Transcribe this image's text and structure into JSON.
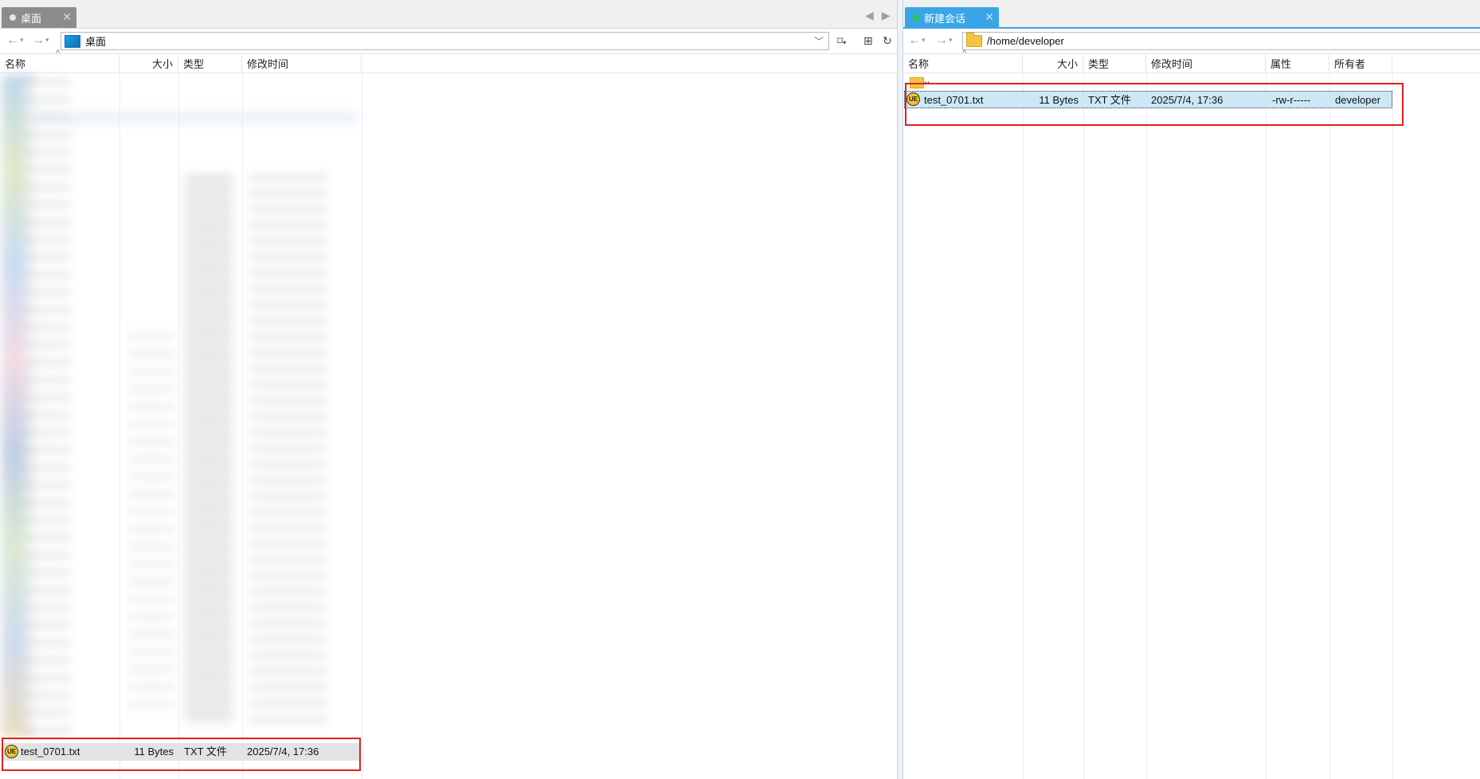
{
  "left_pane": {
    "tab": {
      "label": "桌面"
    },
    "address": "桌面",
    "columns": {
      "name": "名称",
      "size": "大小",
      "type": "类型",
      "modified": "修改时间"
    },
    "file": {
      "name": "test_0701.txt",
      "size": "11 Bytes",
      "type": "TXT 文件",
      "modified": "2025/7/4, 17:36"
    }
  },
  "right_pane": {
    "tab": {
      "label": "新建会话"
    },
    "address": "/home/developer",
    "columns": {
      "name": "名称",
      "size": "大小",
      "type": "类型",
      "modified": "修改时间",
      "attrs": "属性",
      "owner": "所有者"
    },
    "parent_label": "..",
    "file": {
      "name": "test_0701.txt",
      "size": "11 Bytes",
      "type": "TXT 文件",
      "modified": "2025/7/4, 17:36",
      "attrs": "-rw-r-----",
      "owner": "developer"
    }
  },
  "colors": {
    "accent": "#3aa5e6",
    "highlight": "#e02020",
    "selection": "#cce8f6",
    "inactive_tab": "#8c8c8c"
  },
  "icons": {
    "back": "back-arrow-icon",
    "forward": "forward-arrow-icon",
    "bookmark": "bookmark-icon",
    "new_folder": "new-folder-icon",
    "refresh": "refresh-icon",
    "file": "ultraedit-file-icon"
  }
}
